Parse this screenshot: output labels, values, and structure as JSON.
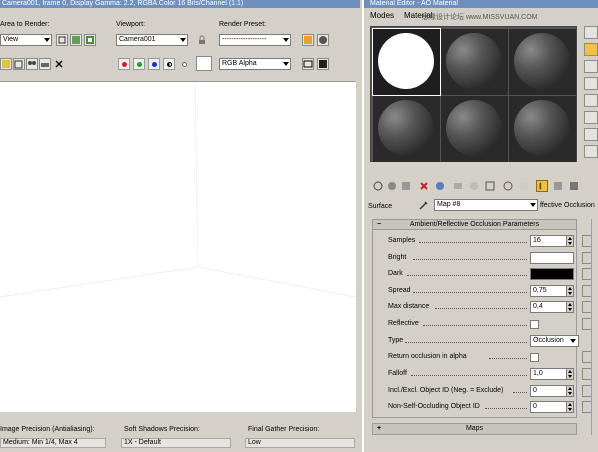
{
  "render_window": {
    "title": "Camera001, frame 0, Display Gamma: 2.2, RGBA Color 16 Bits/Channel (1:1)",
    "area_label": "Area to Render:",
    "area_value": "View",
    "viewport_label": "Viewport:",
    "viewport_value": "Camera001",
    "preset_label": "Render Preset:",
    "preset_value": "-------------------",
    "channel_value": "RGB Alpha",
    "status": {
      "image_precision_label": "Image Precision (Antialiasing):",
      "image_precision_value": "Medium: Min 1/4, Max 4",
      "soft_shadows_label": "Soft Shadows Precision:",
      "soft_shadows_value": "1X - Default",
      "final_gather_label": "Final Gather Precision:",
      "final_gather_value": "Low"
    }
  },
  "material_editor": {
    "title": "Material Editor - AO Material",
    "menu": [
      "Modes",
      "Material"
    ],
    "watermark": "思缘设计论坛 www.MISSVUAN.COM",
    "surface_label": "Surface",
    "map_name": "Map #8",
    "map_type": "ffective Occlusion",
    "rollout_title": "Ambient/Reflective Occlusion Parameters",
    "params": {
      "samples_label": "Samples",
      "samples_value": "16",
      "bright_label": "Bright",
      "dark_label": "Dark",
      "spread_label": "Spread",
      "spread_value": "0,75",
      "max_distance_label": "Max distance",
      "max_distance_value": "0,4",
      "reflective_label": "Reflective",
      "type_label": "Type",
      "type_value": "Occlusion",
      "return_alpha_label": "Return occlusion in alpha",
      "falloff_label": "Falloff",
      "falloff_value": "1,0",
      "incl_excl_label": "Incl./Excl. Object ID (Neg. = Exclude)",
      "incl_excl_value": "0",
      "non_self_label": "Non-Self-Occluding Object ID",
      "non_self_value": "0"
    },
    "maps_rollout": "Maps"
  },
  "colors": {
    "bright_swatch": "#ffffff",
    "dark_swatch": "#000000",
    "title_bar": "#6f8fbf",
    "pressed_button": "#f2c04a"
  }
}
